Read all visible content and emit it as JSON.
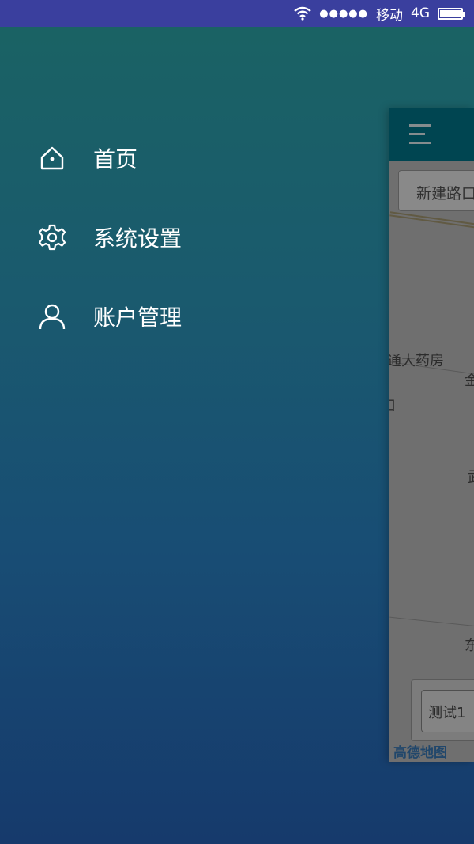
{
  "status_bar": {
    "carrier": "移动",
    "network": "4G",
    "signal_dots": "●●●●●",
    "wifi_icon": "wifi-icon",
    "battery_icon": "battery-icon"
  },
  "drawer": {
    "items": [
      {
        "label": "首页",
        "icon": "home-icon"
      },
      {
        "label": "系统设置",
        "icon": "gear-icon"
      },
      {
        "label": "账户管理",
        "icon": "user-icon"
      }
    ]
  },
  "preview": {
    "header_icon": "menu-icon",
    "search_text": "新建路口",
    "map_labels": [
      "通大药房",
      "金",
      "口",
      "武",
      "东"
    ],
    "card_label": "测试1",
    "map_logo": "高德地图"
  },
  "colors": {
    "status_bar_bg": "#3a3f9e",
    "app_header_bg": "#00778c",
    "background_top": "#1a6363",
    "background_bottom": "#163a6c"
  }
}
